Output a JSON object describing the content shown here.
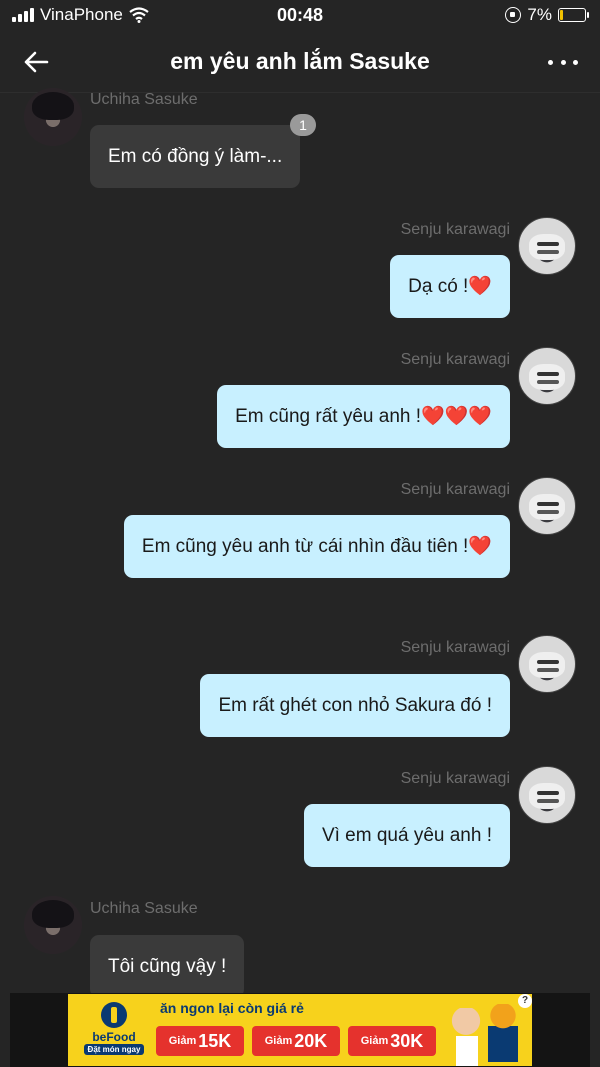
{
  "status_bar": {
    "carrier": "VinaPhone",
    "time": "00:48",
    "battery": "7%"
  },
  "header": {
    "title": "em yêu anh lắm Sasuke"
  },
  "messages": [
    {
      "sender": "Uchiha Sasuke",
      "text": "Em có đồng ý làm-...",
      "badge": "1",
      "heart": ""
    },
    {
      "sender": "Senju karawagi",
      "text": "Dạ có !",
      "heart": "❤️"
    },
    {
      "sender": "Senju karawagi",
      "text": "Em cũng rất yêu anh !",
      "heart": "❤️❤️❤️"
    },
    {
      "sender": "Senju karawagi",
      "text": "Em cũng yêu anh từ cái nhìn đầu tiên !",
      "heart": "❤️"
    },
    {
      "sender": "Senju karawagi",
      "text": "Em rất ghét con nhỏ Sakura đó !",
      "heart": ""
    },
    {
      "sender": "Senju karawagi",
      "text": "Vì em quá yêu anh !",
      "heart": ""
    },
    {
      "sender": "Uchiha Sasuke",
      "text": "Tôi cũng vậy !",
      "heart": ""
    }
  ],
  "ad": {
    "brand": "beFood",
    "cta": "Đặt món ngay",
    "headline": "ăn ngon lại còn giá rẻ",
    "coupon_label": "Giảm",
    "coupons": [
      "15K",
      "20K",
      "30K"
    ],
    "help": "?"
  },
  "colors": {
    "background": "#252525",
    "incoming_bubble": "#3a3a3a",
    "outgoing_bubble": "#c8f0ff",
    "ad_yellow": "#f7d21c"
  }
}
